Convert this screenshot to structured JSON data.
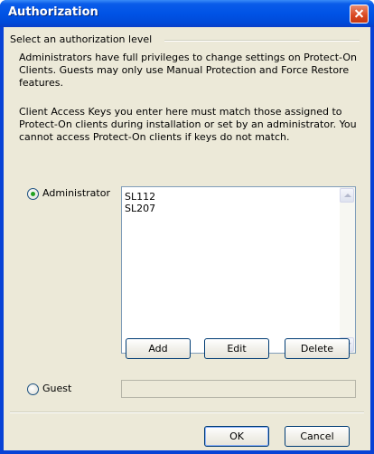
{
  "window": {
    "title": "Authorization"
  },
  "group": {
    "label": "Select an authorization level"
  },
  "info": {
    "paragraph1": "Administrators have full privileges to change settings on Protect-On Clients. Guests may only use Manual Protection and Force Restore features.",
    "paragraph2": "Client Access Keys you enter here must match those assigned to Protect-On clients during installation or set by an administrator. You cannot access Protect-On clients if keys do not match."
  },
  "administrator": {
    "label": "Administrator",
    "selected": true,
    "keys": [
      "SL112",
      "SL207"
    ]
  },
  "key_buttons": {
    "add": "Add",
    "edit": "Edit",
    "delete": "Delete"
  },
  "guest": {
    "label": "Guest",
    "selected": false,
    "value": ""
  },
  "dialog_buttons": {
    "ok": "OK",
    "cancel": "Cancel"
  }
}
